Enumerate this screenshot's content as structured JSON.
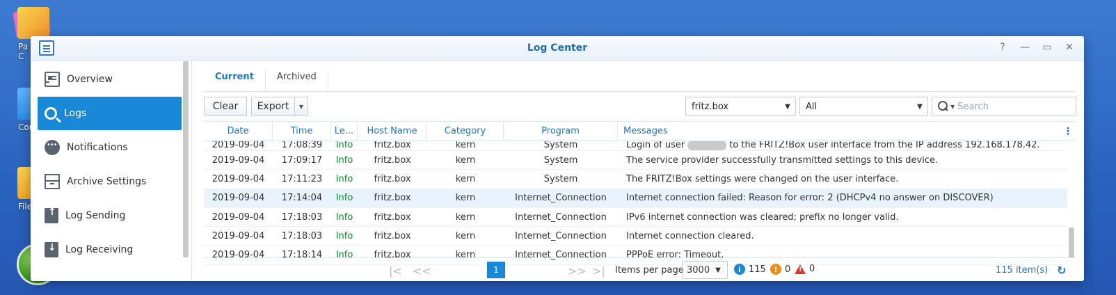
{
  "desktop": {
    "icons": [
      {
        "label": "Pa\nC",
        "icon": "package-center-icon"
      },
      {
        "label": "Cont",
        "icon": "control-panel-icon"
      },
      {
        "label": "File",
        "icon": "file-station-icon"
      }
    ]
  },
  "window": {
    "title": "Log Center",
    "controls": [
      "?",
      "—",
      "▭",
      "✕"
    ]
  },
  "sidebar": {
    "items": [
      {
        "label": "Overview",
        "icon": "overview-icon",
        "active": false
      },
      {
        "label": "Logs",
        "icon": "search-icon",
        "active": true
      },
      {
        "label": "Notifications",
        "icon": "notifications-icon",
        "active": false
      },
      {
        "label": "Archive Settings",
        "icon": "archive-icon",
        "active": false
      },
      {
        "label": "Log Sending",
        "icon": "log-sending-icon",
        "active": false
      },
      {
        "label": "Log Receiving",
        "icon": "log-receiving-icon",
        "active": false
      }
    ]
  },
  "tabs": [
    {
      "label": "Current",
      "active": true
    },
    {
      "label": "Archived",
      "active": false
    }
  ],
  "toolbar": {
    "clear_label": "Clear",
    "export_label": "Export",
    "host_filter": "fritz.box",
    "level_filter": "All",
    "search_placeholder": "Search"
  },
  "grid": {
    "columns": [
      "Date",
      "Time",
      "Le...",
      "Host Name",
      "Category",
      "Program",
      "Messages"
    ],
    "rows": [
      {
        "date": "2019-09-04",
        "time": "17:08:39",
        "level": "Info",
        "host": "fritz.box",
        "category": "kern",
        "program": "System",
        "msg_a": "Login of user",
        "msg_b": "to the FRITZ!Box user interface from the IP address 192.168.178.42."
      },
      {
        "date": "2019-09-04",
        "time": "17:09:17",
        "level": "Info",
        "host": "fritz.box",
        "category": "kern",
        "program": "System",
        "message": "The service provider successfully transmitted settings to this device."
      },
      {
        "date": "2019-09-04",
        "time": "17:11:23",
        "level": "Info",
        "host": "fritz.box",
        "category": "kern",
        "program": "System",
        "message": "The FRITZ!Box settings were changed on the user interface."
      },
      {
        "date": "2019-09-04",
        "time": "17:14:04",
        "level": "Info",
        "host": "fritz.box",
        "category": "kern",
        "program": "Internet_Connection",
        "message": "Internet connection failed: Reason for error: 2 (DHCPv4 no answer on DISCOVER)"
      },
      {
        "date": "2019-09-04",
        "time": "17:18:03",
        "level": "Info",
        "host": "fritz.box",
        "category": "kern",
        "program": "Internet_Connection",
        "message": "IPv6 internet connection was cleared; prefix no longer valid."
      },
      {
        "date": "2019-09-04",
        "time": "17:18:03",
        "level": "Info",
        "host": "fritz.box",
        "category": "kern",
        "program": "Internet_Connection",
        "message": "Internet connection cleared."
      },
      {
        "date": "2019-09-04",
        "time": "17:18:14",
        "level": "Info",
        "host": "fritz.box",
        "category": "kern",
        "program": "Internet_Connection",
        "message": "PPPoE error: Timeout."
      }
    ]
  },
  "footer": {
    "current_page": "1",
    "items_per_page_label": "Items per page",
    "items_per_page": "3000",
    "info_count": "115",
    "warn_count": "0",
    "error_count": "0",
    "total_items": "115 item(s)"
  },
  "colors": {
    "accent": "#1a88d8",
    "info_level": "#0c8a2e",
    "warning": "#f08c1a",
    "error": "#e0352b"
  }
}
